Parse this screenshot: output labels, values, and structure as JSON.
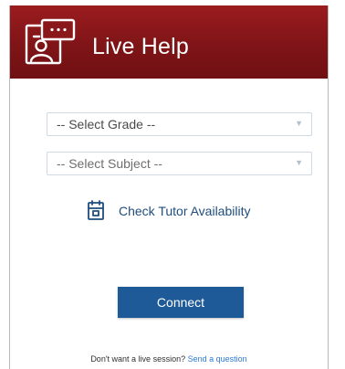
{
  "header": {
    "title": "Live Help",
    "icon": "chat-support-icon"
  },
  "form": {
    "grade_select": {
      "selected": "-- Select Grade --"
    },
    "subject_select": {
      "selected": "-- Select Subject --"
    },
    "availability": {
      "label": "Check Tutor Availability",
      "icon": "calendar-icon"
    },
    "connect_label": "Connect"
  },
  "footer": {
    "prompt": "Don't want a live session?",
    "link": "Send a question"
  },
  "colors": {
    "header": "#7f1417",
    "primary_button": "#1e5a98",
    "link": "#2c7ad6"
  }
}
